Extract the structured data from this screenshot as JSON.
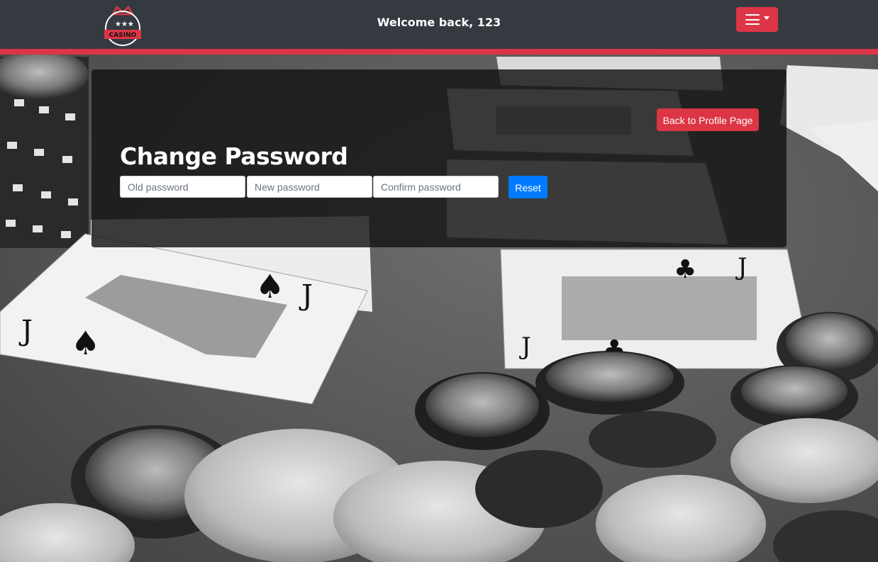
{
  "navbar": {
    "welcome": "Welcome back, 123",
    "logo_icon": "casino-crown-logo-icon",
    "logo_text": "CASINO",
    "menu_icon": "hamburger-menu-icon",
    "accent_color": "#dc3545",
    "bar_color": "#343a40"
  },
  "panel": {
    "title": "Change Password",
    "back_button": "Back to Profile Page",
    "inputs": {
      "old_placeholder": "Old password",
      "new_placeholder": "New password",
      "confirm_placeholder": "Confirm password"
    },
    "reset_button": "Reset",
    "primary_color": "#007bff"
  },
  "background": {
    "description_icon": "poker-table-background-image"
  }
}
